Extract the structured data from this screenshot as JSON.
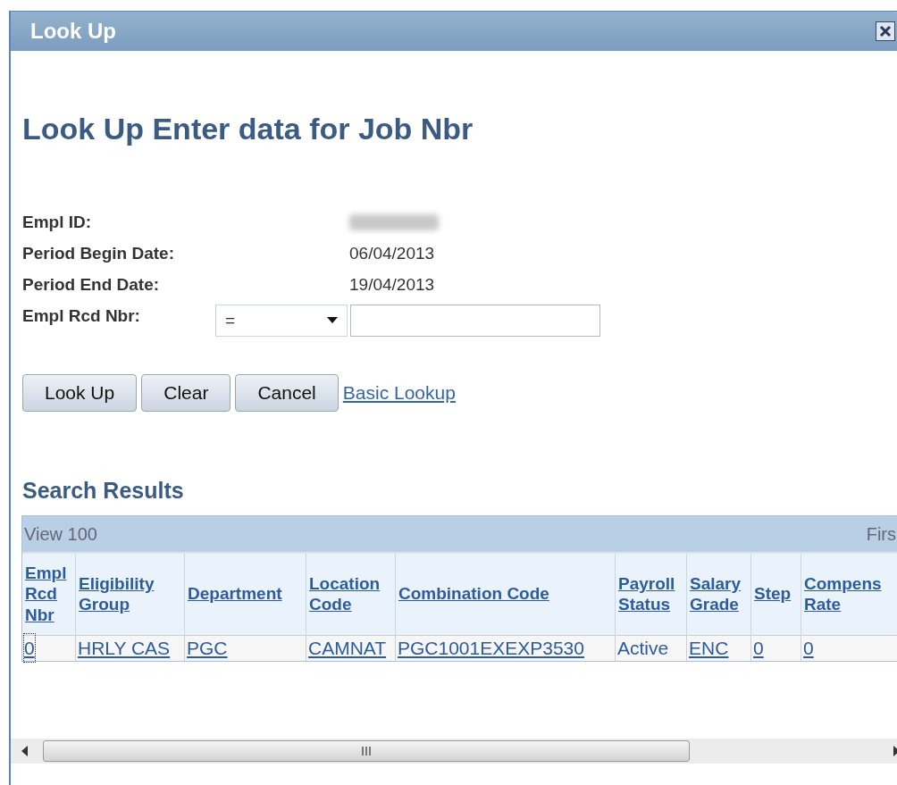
{
  "window": {
    "title": "Look Up"
  },
  "heading": "Look Up Enter data for Job Nbr",
  "fields": [
    {
      "kind": "blurred",
      "label": "Empl ID:"
    },
    {
      "kind": "text",
      "label": "Period Begin Date:",
      "value": "06/04/2013"
    },
    {
      "kind": "text",
      "label": "Period End Date:",
      "value": "19/04/2013"
    },
    {
      "kind": "criteria",
      "label": "Empl Rcd Nbr:",
      "operator": "="
    }
  ],
  "buttons": [
    "Look Up",
    "Clear",
    "Cancel"
  ],
  "basic_lookup_link": "Basic Lookup",
  "results": {
    "title": "Search Results",
    "view": "View 100",
    "nav": "Firs",
    "columns": [
      "Empl Rcd Nbr",
      "Eligibility Group",
      "Department",
      "Location Code",
      "Combination Code",
      "Payroll Status",
      "Salary Grade",
      "Step",
      "Compens Rate"
    ],
    "rows": [
      [
        {
          "text": "0",
          "link": true,
          "focused": true
        },
        {
          "text": "HRLY CAS",
          "link": true,
          "focused": false
        },
        {
          "text": "PGC",
          "link": true,
          "focused": false
        },
        {
          "text": "CAMNAT",
          "link": true,
          "focused": false
        },
        {
          "text": "PGC1001EXEXP3530",
          "link": true,
          "focused": false
        },
        {
          "text": "Active",
          "link": false,
          "focused": false
        },
        {
          "text": "ENC",
          "link": true,
          "focused": false
        },
        {
          "text": "0",
          "link": true,
          "focused": false
        },
        {
          "text": "0",
          "link": true,
          "focused": false
        }
      ]
    ]
  }
}
